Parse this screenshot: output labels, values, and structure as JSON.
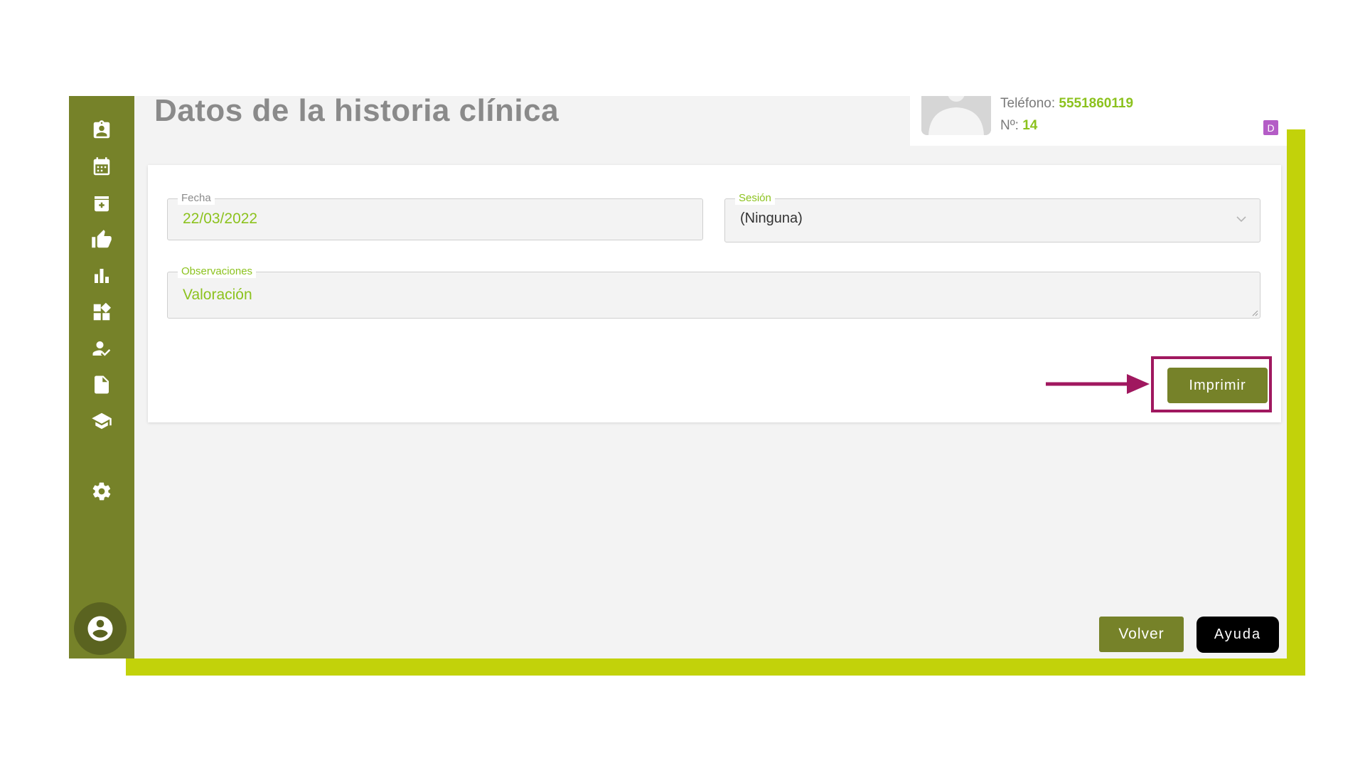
{
  "page": {
    "title": "Datos de la historia clínica"
  },
  "colors": {
    "sidebar": "#768229",
    "accent_green": "#8cc21e",
    "lime_frame": "#c2d20a",
    "highlight": "#a0185f",
    "badge": "#b45cc6"
  },
  "sidebar": {
    "items": [
      {
        "icon": "clipboard-user-icon"
      },
      {
        "icon": "calendar-icon"
      },
      {
        "icon": "medical-box-icon"
      },
      {
        "icon": "thumbs-up-icon"
      },
      {
        "icon": "bar-chart-icon"
      },
      {
        "icon": "widgets-icon"
      },
      {
        "icon": "user-check-icon"
      },
      {
        "icon": "document-icon"
      },
      {
        "icon": "graduation-cap-icon"
      },
      {
        "icon": "gear-icon"
      }
    ],
    "profile_icon": "account-circle-icon"
  },
  "patient": {
    "phone_label": "Teléfono:",
    "phone_value": "5551860119",
    "number_label": "Nº:",
    "number_value": "14",
    "badge": "D"
  },
  "form": {
    "fecha_label": "Fecha",
    "fecha_value": "22/03/2022",
    "sesion_label": "Sesión",
    "sesion_value": "(Ninguna)",
    "observaciones_label": "Observaciones",
    "observaciones_value": "Valoración"
  },
  "actions": {
    "print_label": "Imprimir",
    "back_label": "Volver",
    "help_label": "Ayuda"
  }
}
